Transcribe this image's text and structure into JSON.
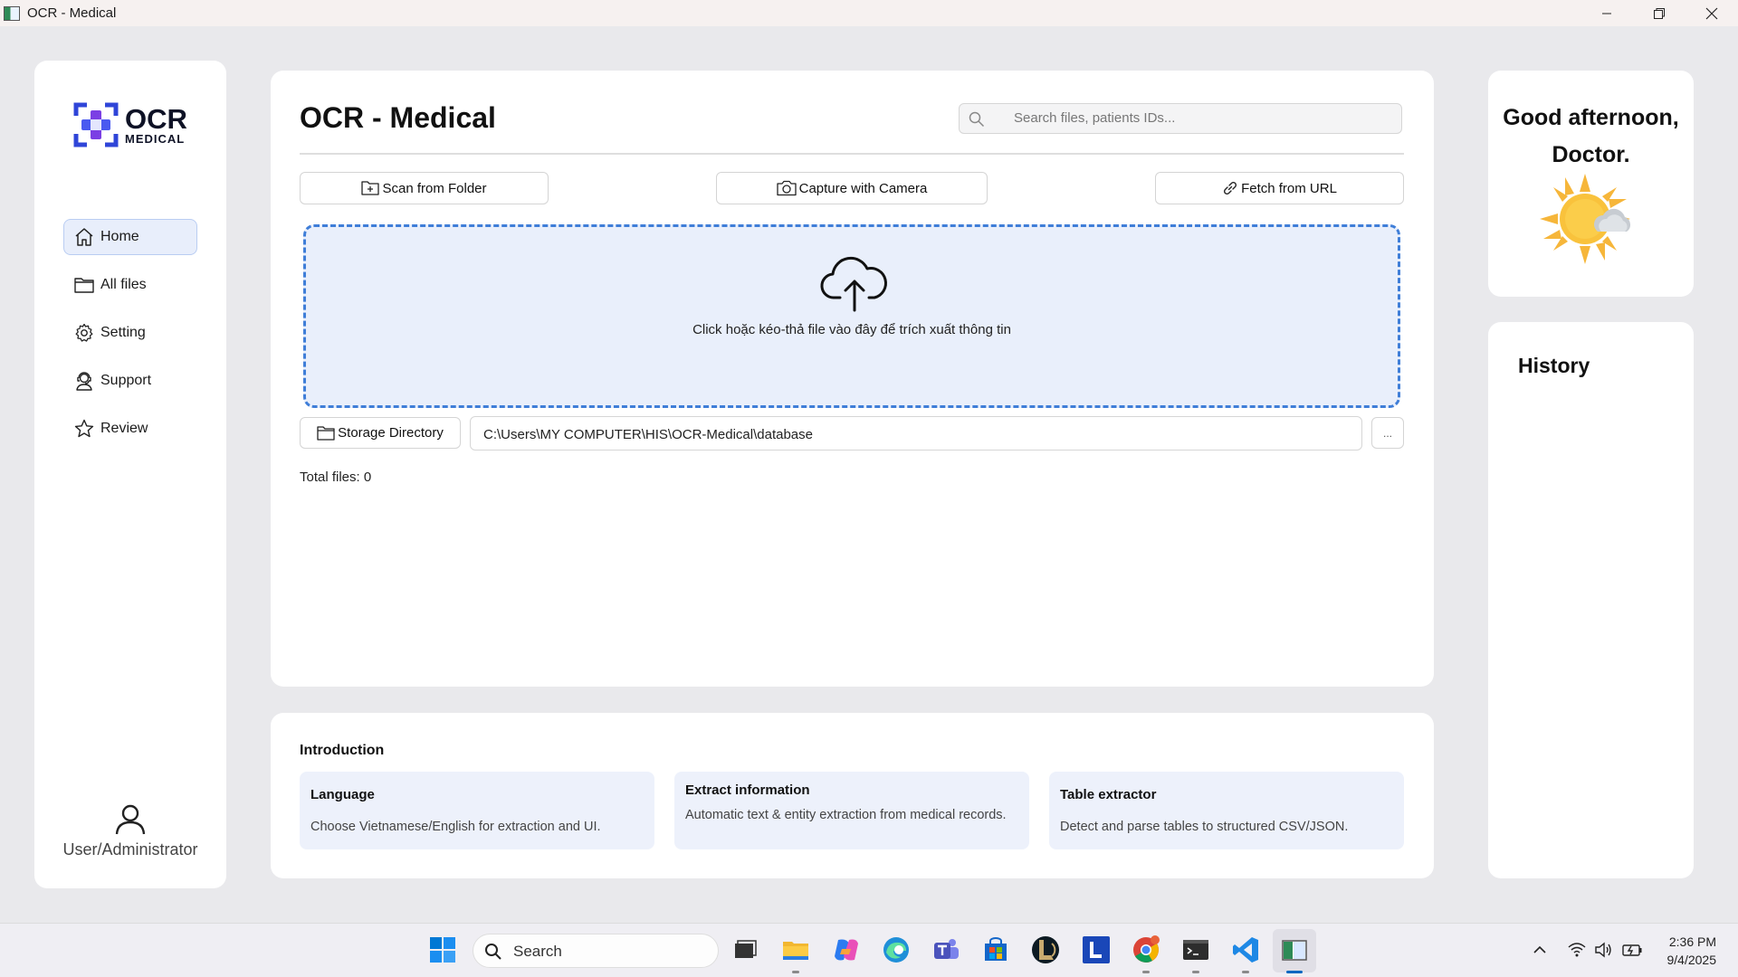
{
  "window": {
    "title": "OCR - Medical"
  },
  "sidebar": {
    "logo_big": "OCR",
    "logo_small": "MEDICAL",
    "items": [
      {
        "label": "Home",
        "icon": "home-icon",
        "active": true
      },
      {
        "label": "All files",
        "icon": "folder-icon",
        "active": false
      },
      {
        "label": "Setting",
        "icon": "gear-icon",
        "active": false
      },
      {
        "label": "Support",
        "icon": "support-agent-icon",
        "active": false
      },
      {
        "label": "Review",
        "icon": "star-icon",
        "active": false
      }
    ],
    "user_label": "User/Administrator"
  },
  "main": {
    "title": "OCR - Medical",
    "search_placeholder": "Search files, patients IDs...",
    "buttons": {
      "scan": "Scan from Folder",
      "camera": "Capture with Camera",
      "url": "Fetch from URL"
    },
    "dropzone_text": "Click hoặc kéo-thả file vào đây để trích xuất thông tin",
    "storage_button": "Storage Directory",
    "storage_path": "C:\\Users\\MY COMPUTER\\HIS\\OCR-Medical\\database",
    "browse_button": "...",
    "total_files": "Total files: 0"
  },
  "intro": {
    "title": "Introduction",
    "features": [
      {
        "title": "Language",
        "desc": "Choose Vietnamese/English for extraction and UI."
      },
      {
        "title": "Extract information",
        "desc": "Automatic text & entity extraction from medical records."
      },
      {
        "title": "Table extractor",
        "desc": "Detect and parse tables to structured CSV/JSON."
      }
    ]
  },
  "greeting": {
    "line1": "Good afternoon,",
    "line2": "Doctor.",
    "weather_icon": "sun-cloud-icon"
  },
  "history": {
    "title": "History"
  },
  "taskbar": {
    "search_label": "Search",
    "time": "2:36 PM",
    "date": "9/4/2025"
  },
  "colors": {
    "accent": "#3f7ed8",
    "dropzone_bg": "#e9effb",
    "active_nav_bg": "#e8eefb",
    "logo_blue": "#2f45d8",
    "logo_purple": "#7b3fe4"
  }
}
